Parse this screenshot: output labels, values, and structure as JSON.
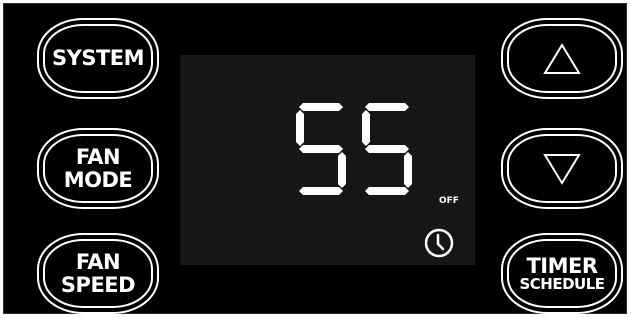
{
  "buttons": {
    "system": "SYSTEM",
    "fan_mode": [
      "FAN",
      "MODE"
    ],
    "fan_speed": [
      "FAN",
      "SPEED"
    ],
    "timer_schedule": [
      "TIMER",
      "SCHEDULE"
    ]
  },
  "display": {
    "temperature": "55",
    "status": "OFF"
  },
  "icons": {
    "up": "up-triangle-icon",
    "down": "down-triangle-icon",
    "clock": "clock-icon"
  },
  "colors": {
    "panel": "#000000",
    "screen": "#161616",
    "foreground": "#ffffff"
  }
}
